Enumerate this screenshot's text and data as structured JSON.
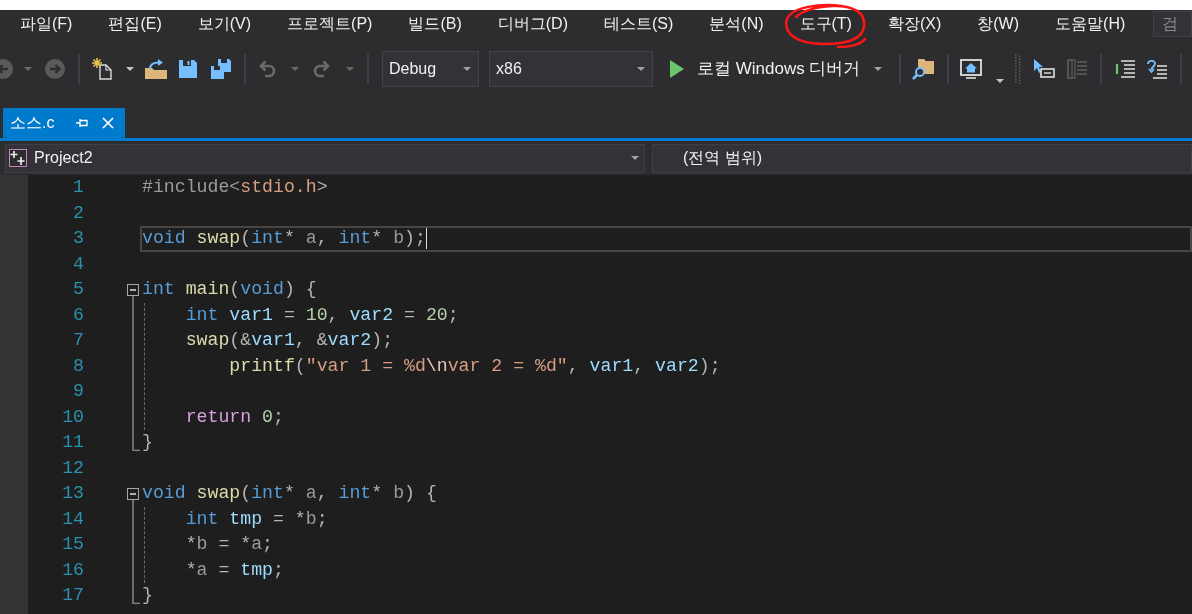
{
  "menu": [
    {
      "label": "파일(F)",
      "circled": false
    },
    {
      "label": "편집(E)",
      "circled": false
    },
    {
      "label": "보기(V)",
      "circled": false
    },
    {
      "label": "프로젝트(P)",
      "circled": false
    },
    {
      "label": "빌드(B)",
      "circled": false
    },
    {
      "label": "디버그(D)",
      "circled": false
    },
    {
      "label": "테스트(S)",
      "circled": false
    },
    {
      "label": "분석(N)",
      "circled": false
    },
    {
      "label": "도구(T)",
      "circled": true
    },
    {
      "label": "확장(X)",
      "circled": false
    },
    {
      "label": "창(W)",
      "circled": false
    },
    {
      "label": "도움말(H)",
      "circled": false
    }
  ],
  "search": {
    "placeholder": "검"
  },
  "toolbar": [
    {
      "kind": "back",
      "disabled": true
    },
    {
      "kind": "forward",
      "disabled": true
    },
    {
      "kind": "separator"
    },
    {
      "kind": "new",
      "disabled": false
    },
    {
      "kind": "open",
      "disabled": false
    },
    {
      "kind": "save",
      "disabled": false
    },
    {
      "kind": "saveall",
      "disabled": false
    },
    {
      "kind": "separator"
    },
    {
      "kind": "undo",
      "disabled": true
    },
    {
      "kind": "redo",
      "disabled": true
    },
    {
      "kind": "separator"
    },
    {
      "kind": "dropdown",
      "value": "Debug"
    },
    {
      "kind": "dropdown",
      "value": "x86"
    },
    {
      "kind": "run",
      "label": "로컬 Windows 디버거"
    },
    {
      "kind": "separator"
    },
    {
      "kind": "find",
      "disabled": false
    },
    {
      "kind": "separator"
    },
    {
      "kind": "screen",
      "disabled": false
    },
    {
      "kind": "grip"
    },
    {
      "kind": "pointer",
      "disabled": false
    },
    {
      "kind": "panel",
      "disabled": true
    },
    {
      "kind": "separator"
    },
    {
      "kind": "indent",
      "disabled": false
    },
    {
      "kind": "wrap",
      "disabled": false
    },
    {
      "kind": "separator"
    }
  ],
  "tabs": [
    {
      "label": "소스.c",
      "selected": true
    }
  ],
  "navigation": {
    "project": "Project2",
    "scope": "(전역 범위)"
  },
  "editor": {
    "lines": [
      {
        "number": "1",
        "kind": "plain",
        "current": false,
        "tokens": [
          {
            "text": "#include<",
            "kind": "preproc"
          },
          {
            "text": "stdio.h",
            "kind": "include"
          },
          {
            "text": ">",
            "kind": "punct"
          }
        ]
      },
      {
        "number": "2",
        "kind": "plain",
        "current": false
      },
      {
        "number": "3",
        "kind": "plain",
        "current": true,
        "tokens": [
          {
            "text": "void ",
            "kind": "keyword"
          },
          {
            "text": "swap",
            "kind": "function"
          },
          {
            "text": "(",
            "kind": "punct"
          },
          {
            "text": "int",
            "kind": "keyword"
          },
          {
            "text": "* ",
            "kind": "punct"
          },
          {
            "text": "a",
            "kind": "param"
          },
          {
            "text": ", ",
            "kind": "punct"
          },
          {
            "text": "int",
            "kind": "keyword"
          },
          {
            "text": "* ",
            "kind": "punct"
          },
          {
            "text": "b",
            "kind": "param"
          },
          {
            "text": ");",
            "kind": "punct"
          }
        ]
      },
      {
        "number": "4",
        "kind": "plain",
        "current": false
      },
      {
        "number": "5",
        "kind": "opener",
        "current": false,
        "tokens": [
          {
            "text": "int ",
            "kind": "keyword"
          },
          {
            "text": "main",
            "kind": "function"
          },
          {
            "text": "(",
            "kind": "punct"
          },
          {
            "text": "void",
            "kind": "keyword"
          },
          {
            "text": ") {",
            "kind": "punct"
          }
        ]
      },
      {
        "number": "6",
        "kind": "inner",
        "current": false,
        "tokens": [
          {
            "text": "    int ",
            "kind": "keyword"
          },
          {
            "text": "var1",
            "kind": "local"
          },
          {
            "text": " = ",
            "kind": "punct"
          },
          {
            "text": "10",
            "kind": "number"
          },
          {
            "text": ", ",
            "kind": "punct"
          },
          {
            "text": "var2",
            "kind": "local"
          },
          {
            "text": " = ",
            "kind": "punct"
          },
          {
            "text": "20",
            "kind": "number"
          },
          {
            "text": ";",
            "kind": "punct"
          }
        ]
      },
      {
        "number": "7",
        "kind": "inner",
        "current": false,
        "tokens": [
          {
            "text": "    swap",
            "kind": "function"
          },
          {
            "text": "(&",
            "kind": "punct"
          },
          {
            "text": "var1",
            "kind": "local"
          },
          {
            "text": ", &",
            "kind": "punct"
          },
          {
            "text": "var2",
            "kind": "local"
          },
          {
            "text": ");",
            "kind": "punct"
          }
        ]
      },
      {
        "number": "8",
        "kind": "inner",
        "current": false,
        "tokens": [
          {
            "text": "        printf",
            "kind": "function"
          },
          {
            "text": "(",
            "kind": "punct"
          },
          {
            "text": "\"var 1 = %d",
            "kind": "string"
          },
          {
            "text": "\\n",
            "kind": "escape"
          },
          {
            "text": "var 2 = %d\"",
            "kind": "string"
          },
          {
            "text": ", ",
            "kind": "punct"
          },
          {
            "text": "var1",
            "kind": "local"
          },
          {
            "text": ", ",
            "kind": "punct"
          },
          {
            "text": "var2",
            "kind": "local"
          },
          {
            "text": ");",
            "kind": "punct"
          }
        ]
      },
      {
        "number": "9",
        "kind": "inner",
        "current": false
      },
      {
        "number": "10",
        "kind": "inner",
        "current": false,
        "tokens": [
          {
            "text": "    return ",
            "kind": "control"
          },
          {
            "text": "0",
            "kind": "number"
          },
          {
            "text": ";",
            "kind": "punct"
          }
        ]
      },
      {
        "number": "11",
        "kind": "closer",
        "current": false,
        "tokens": [
          {
            "text": "}",
            "kind": "punct"
          }
        ]
      },
      {
        "number": "12",
        "kind": "plain",
        "current": false
      },
      {
        "number": "13",
        "kind": "opener",
        "current": false,
        "tokens": [
          {
            "text": "void ",
            "kind": "keyword"
          },
          {
            "text": "swap",
            "kind": "function"
          },
          {
            "text": "(",
            "kind": "punct"
          },
          {
            "text": "int",
            "kind": "keyword"
          },
          {
            "text": "* ",
            "kind": "punct"
          },
          {
            "text": "a",
            "kind": "param"
          },
          {
            "text": ", ",
            "kind": "punct"
          },
          {
            "text": "int",
            "kind": "keyword"
          },
          {
            "text": "* ",
            "kind": "punct"
          },
          {
            "text": "b",
            "kind": "param"
          },
          {
            "text": ") {",
            "kind": "punct"
          }
        ]
      },
      {
        "number": "14",
        "kind": "inner",
        "current": false,
        "tokens": [
          {
            "text": "    int ",
            "kind": "keyword"
          },
          {
            "text": "tmp",
            "kind": "local"
          },
          {
            "text": " = *",
            "kind": "punct"
          },
          {
            "text": "b",
            "kind": "param"
          },
          {
            "text": ";",
            "kind": "punct"
          }
        ]
      },
      {
        "number": "15",
        "kind": "inner",
        "current": false,
        "tokens": [
          {
            "text": "    *",
            "kind": "punct"
          },
          {
            "text": "b",
            "kind": "param"
          },
          {
            "text": " = *",
            "kind": "punct"
          },
          {
            "text": "a",
            "kind": "param"
          },
          {
            "text": ";",
            "kind": "punct"
          }
        ]
      },
      {
        "number": "16",
        "kind": "inner",
        "current": false,
        "tokens": [
          {
            "text": "    *",
            "kind": "punct"
          },
          {
            "text": "a",
            "kind": "param"
          },
          {
            "text": " = ",
            "kind": "punct"
          },
          {
            "text": "tmp",
            "kind": "local"
          },
          {
            "text": ";",
            "kind": "punct"
          }
        ]
      },
      {
        "number": "17",
        "kind": "closer",
        "current": false,
        "tokens": [
          {
            "text": "}",
            "kind": "punct"
          }
        ]
      }
    ]
  }
}
